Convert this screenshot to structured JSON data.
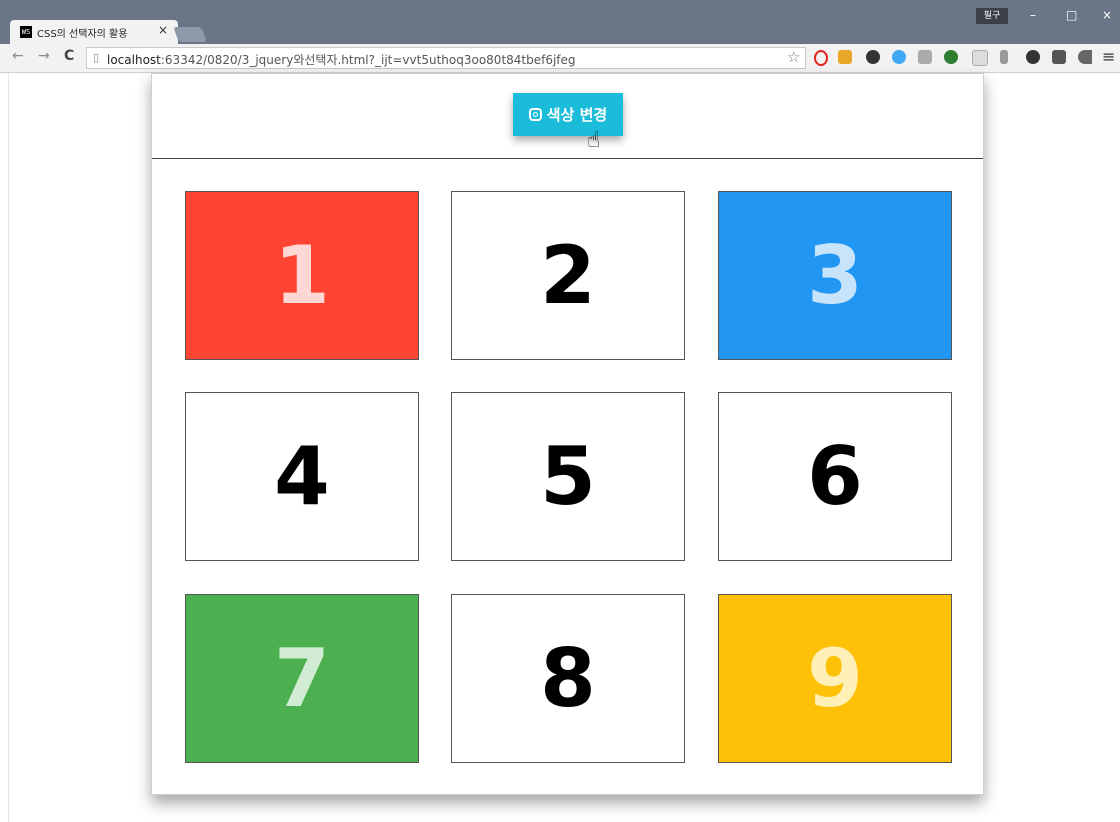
{
  "browser": {
    "tab_title": "CSS의 선택자의 활용",
    "tab_favicon": "WS",
    "tab_close": "×",
    "user_badge": "필구",
    "url_host": "localhost",
    "url_rest": ":63342/0820/3_jquery와선택자.html?_ijt=vvt5uthoq3oo80t84tbef6jfeg",
    "nav_back": "←",
    "nav_forward": "→",
    "nav_reload": "C",
    "star": "☆",
    "menu": "≡",
    "win_min": "–",
    "win_max": "□",
    "win_close": "×"
  },
  "page": {
    "button_label": "색상 변경",
    "button_icon": "instagram-icon",
    "boxes": [
      {
        "label": "1",
        "bg": "#ff4433",
        "fg": "#ffd7d4"
      },
      {
        "label": "2",
        "bg": "#ffffff",
        "fg": "#000000"
      },
      {
        "label": "3",
        "bg": "#2196f3",
        "fg": "#c8e4fb"
      },
      {
        "label": "4",
        "bg": "#ffffff",
        "fg": "#000000"
      },
      {
        "label": "5",
        "bg": "#ffffff",
        "fg": "#000000"
      },
      {
        "label": "6",
        "bg": "#ffffff",
        "fg": "#000000"
      },
      {
        "label": "7",
        "bg": "#4caf50",
        "fg": "#d2ecd4"
      },
      {
        "label": "8",
        "bg": "#ffffff",
        "fg": "#000000"
      },
      {
        "label": "9",
        "bg": "#ffc107",
        "fg": "#fff0b8"
      }
    ]
  }
}
